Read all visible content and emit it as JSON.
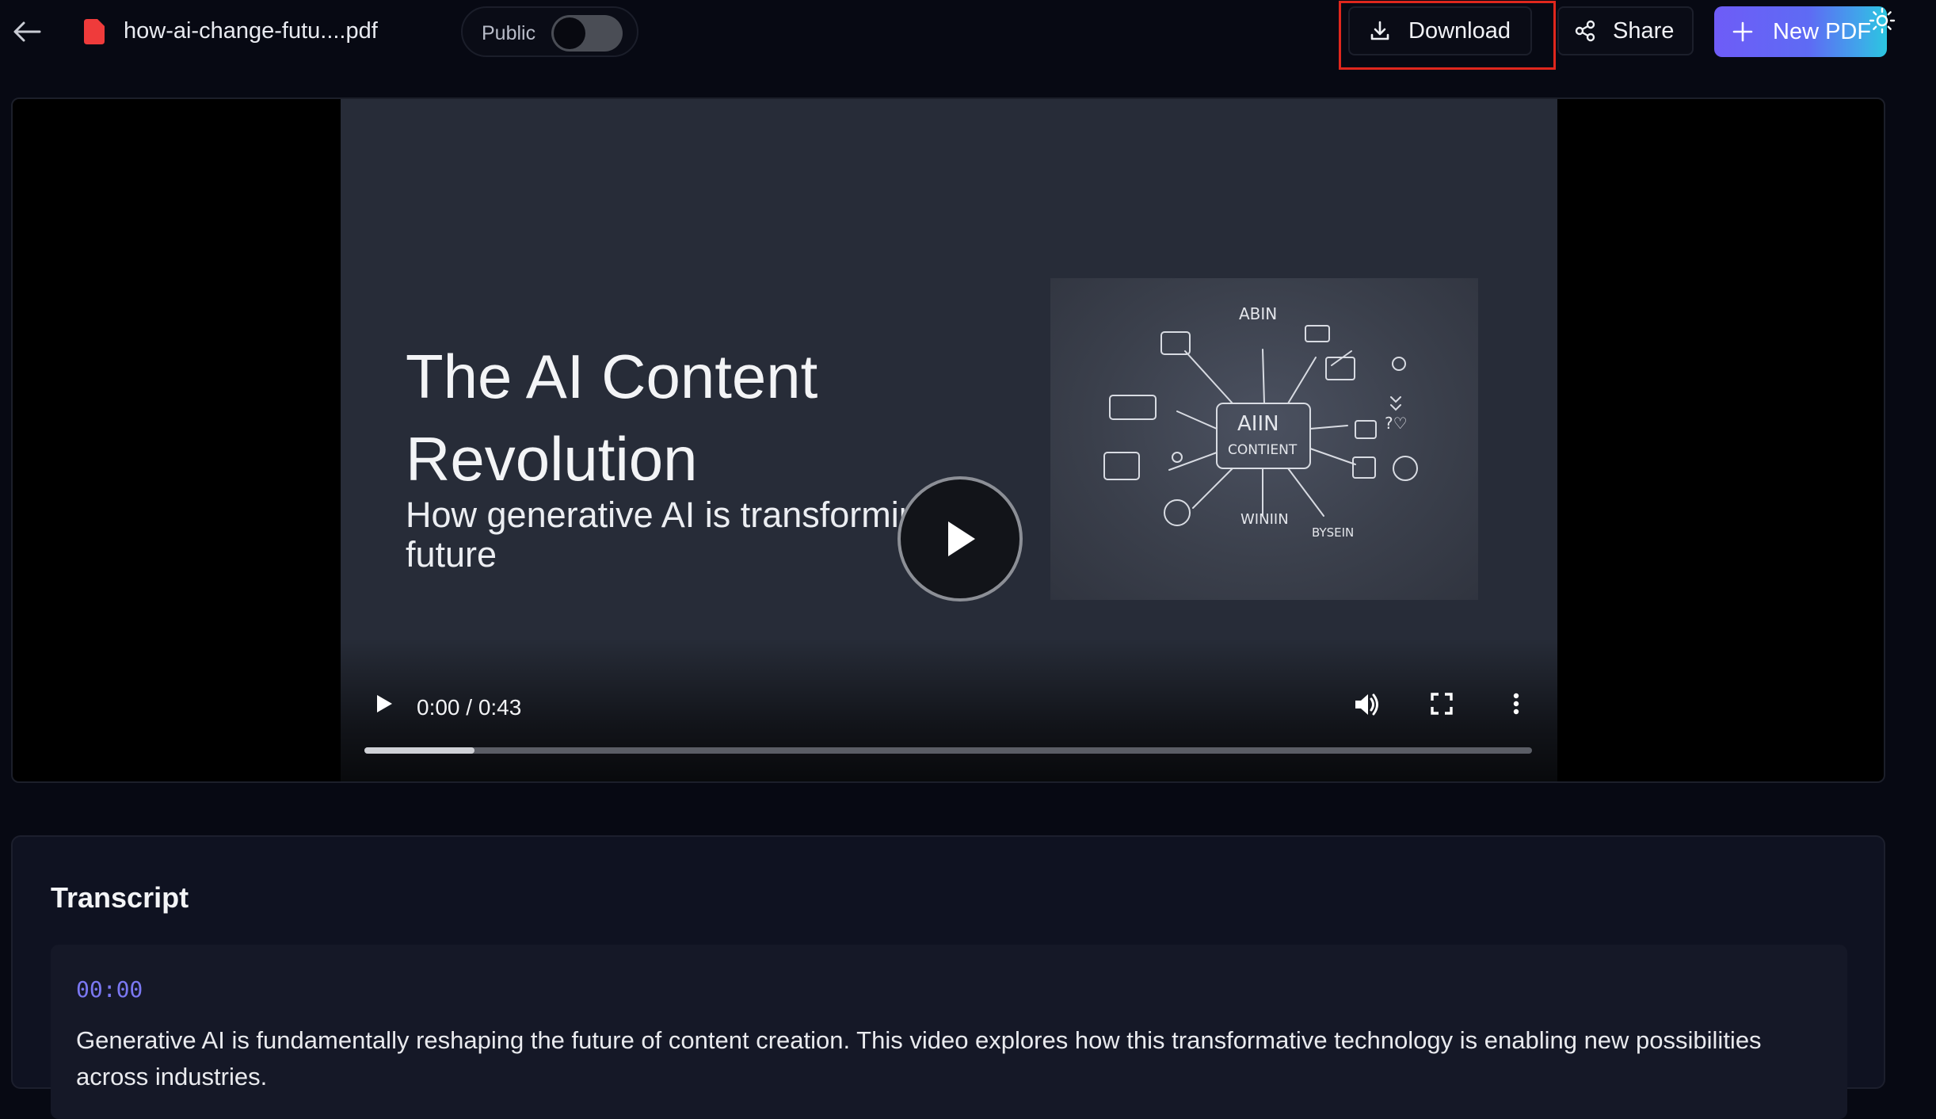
{
  "header": {
    "file_name": "how-ai-change-futu....pdf",
    "public_label": "Public",
    "public_enabled": false,
    "download_label": "Download",
    "share_label": "Share",
    "new_pdf_label": "New PDF",
    "icons": [
      "back-arrow-icon",
      "pdf-file-icon",
      "download-icon",
      "share-icon",
      "plus-icon",
      "sun-icon"
    ]
  },
  "video": {
    "slide_title": "The AI Content\nRevolution",
    "slide_subtitle": "How generative AI is transforming the future",
    "current_time": "0:00",
    "duration": "0:43",
    "time_display": "0:00 / 0:43",
    "progress_fraction": 0.094
  },
  "transcript": {
    "title": "Transcript",
    "entries": [
      {
        "timestamp": "00:00",
        "text": "Generative AI is fundamentally reshaping the future of content creation. This video explores how this transformative technology is enabling new possibilities across industries."
      }
    ]
  },
  "colors": {
    "background": "#070913",
    "accent_purple": "#6e5cf7",
    "accent_cyan": "#2bc6e0",
    "highlight_red": "#e0271d",
    "timestamp": "#7b78f2"
  }
}
